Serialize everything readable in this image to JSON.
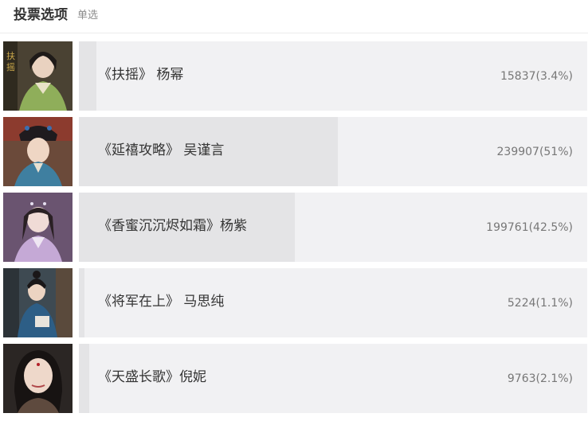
{
  "header": {
    "title": "投票选项",
    "mode": "单选"
  },
  "options": [
    {
      "label": "《扶摇》 杨幂",
      "count": "15837(3.4%)",
      "percent": 3.4,
      "thumb": "portrait-fuyao-yangmi"
    },
    {
      "label": "《延禧攻略》 吴谨言",
      "count": "239907(51%)",
      "percent": 51,
      "thumb": "portrait-yanxi-wujinyan"
    },
    {
      "label": "《香蜜沉沉烬如霜》杨紫",
      "count": "199761(42.5%)",
      "percent": 42.5,
      "thumb": "portrait-xiangmi-yangzi"
    },
    {
      "label": "《将军在上》 马思纯",
      "count": "5224(1.1%)",
      "percent": 1.1,
      "thumb": "portrait-jiangjun-masichun"
    },
    {
      "label": "《天盛长歌》倪妮",
      "count": "9763(2.1%)",
      "percent": 2.1,
      "thumb": "portrait-tiansheng-nini"
    }
  ],
  "colors": {
    "bar_track": "#f1f1f3",
    "bar_fill": "#e4e4e6"
  }
}
